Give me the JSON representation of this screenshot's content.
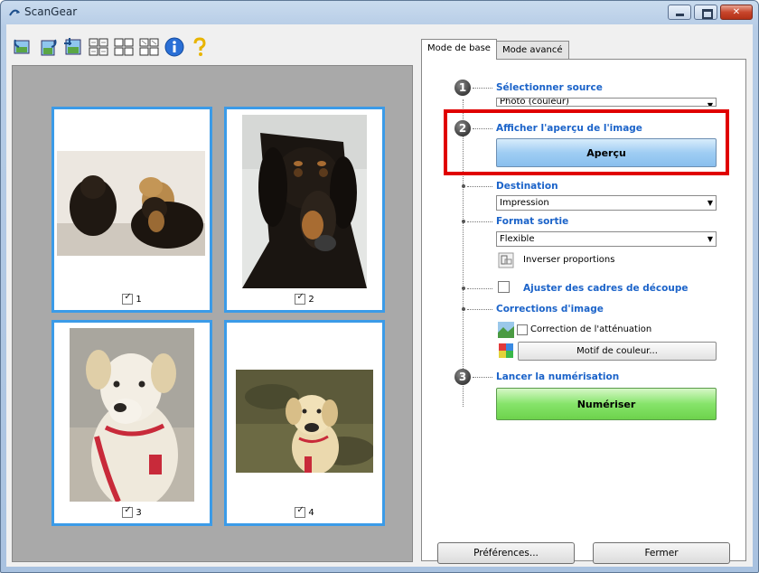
{
  "window": {
    "title": "ScanGear"
  },
  "tabs": [
    {
      "label": "Mode de base",
      "active": true
    },
    {
      "label": "Mode avancé",
      "active": false
    }
  ],
  "thumbnails": [
    {
      "number": "1",
      "checked": true
    },
    {
      "number": "2",
      "checked": true
    },
    {
      "number": "3",
      "checked": true
    },
    {
      "number": "4",
      "checked": true
    }
  ],
  "steps": {
    "step1": {
      "number": "1",
      "label": "Sélectionner source",
      "select_value": "Photo (couleur)"
    },
    "step2": {
      "number": "2",
      "label": "Afficher l'aperçu de l'image",
      "button": "Aperçu"
    },
    "destination": {
      "label": "Destination",
      "select_value": "Impression"
    },
    "format": {
      "label": "Format sortie",
      "select_value": "Flexible",
      "invert_label": "Inverser proportions"
    },
    "crop": {
      "label": "Ajuster des cadres de découpe"
    },
    "corrections": {
      "label": "Corrections d'image",
      "fading_label": "Correction de l'atténuation",
      "color_button": "Motif de couleur..."
    },
    "step3": {
      "number": "3",
      "label": "Lancer la numérisation",
      "button": "Numériser"
    }
  },
  "footer": {
    "preferences": "Préférences...",
    "close": "Fermer"
  },
  "colors": {
    "accent_blue": "#1b63c9",
    "highlight_red": "#e00000",
    "thumb_border": "#3b9be8"
  }
}
